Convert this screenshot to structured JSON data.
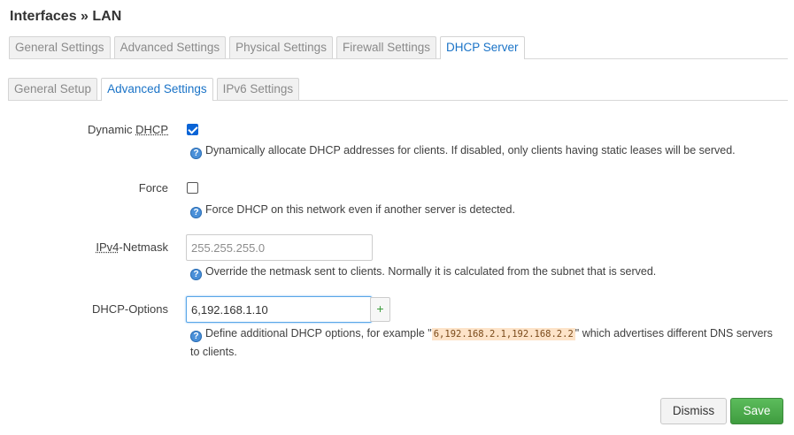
{
  "page": {
    "title": "Interfaces » LAN"
  },
  "primary_tabs": [
    {
      "label": "General Settings",
      "active": false
    },
    {
      "label": "Advanced Settings",
      "active": false
    },
    {
      "label": "Physical Settings",
      "active": false
    },
    {
      "label": "Firewall Settings",
      "active": false
    },
    {
      "label": "DHCP Server",
      "active": true
    }
  ],
  "secondary_tabs": [
    {
      "label": "General Setup",
      "active": false
    },
    {
      "label": "Advanced Settings",
      "active": true
    },
    {
      "label": "IPv6 Settings",
      "active": false
    }
  ],
  "fields": {
    "dynamic_dhcp": {
      "label_prefix": "Dynamic ",
      "label_abbr": "DHCP",
      "checked": true,
      "help": "Dynamically allocate DHCP addresses for clients. If disabled, only clients having static leases will be served."
    },
    "force": {
      "label": "Force",
      "checked": false,
      "help": "Force DHCP on this network even if another server is detected."
    },
    "netmask": {
      "label_abbr": "IPv4",
      "label_suffix": "-Netmask",
      "placeholder": "255.255.255.0",
      "value": "",
      "help": "Override the netmask sent to clients. Normally it is calculated from the subnet that is served."
    },
    "dhcp_options": {
      "label": "DHCP-Options",
      "value": "6,192.168.1.10",
      "add_label": "+",
      "help_before": "Define additional DHCP options, for example \"",
      "help_code": "6,192.168.2.1,192.168.2.2",
      "help_after": "\" which advertises different DNS servers to clients."
    }
  },
  "help_icon_glyph": "?",
  "buttons": {
    "dismiss": "Dismiss",
    "save": "Save"
  },
  "colors": {
    "accent": "#1a73c7",
    "save": "#4caf50",
    "checkbox": "#0a64d6"
  }
}
